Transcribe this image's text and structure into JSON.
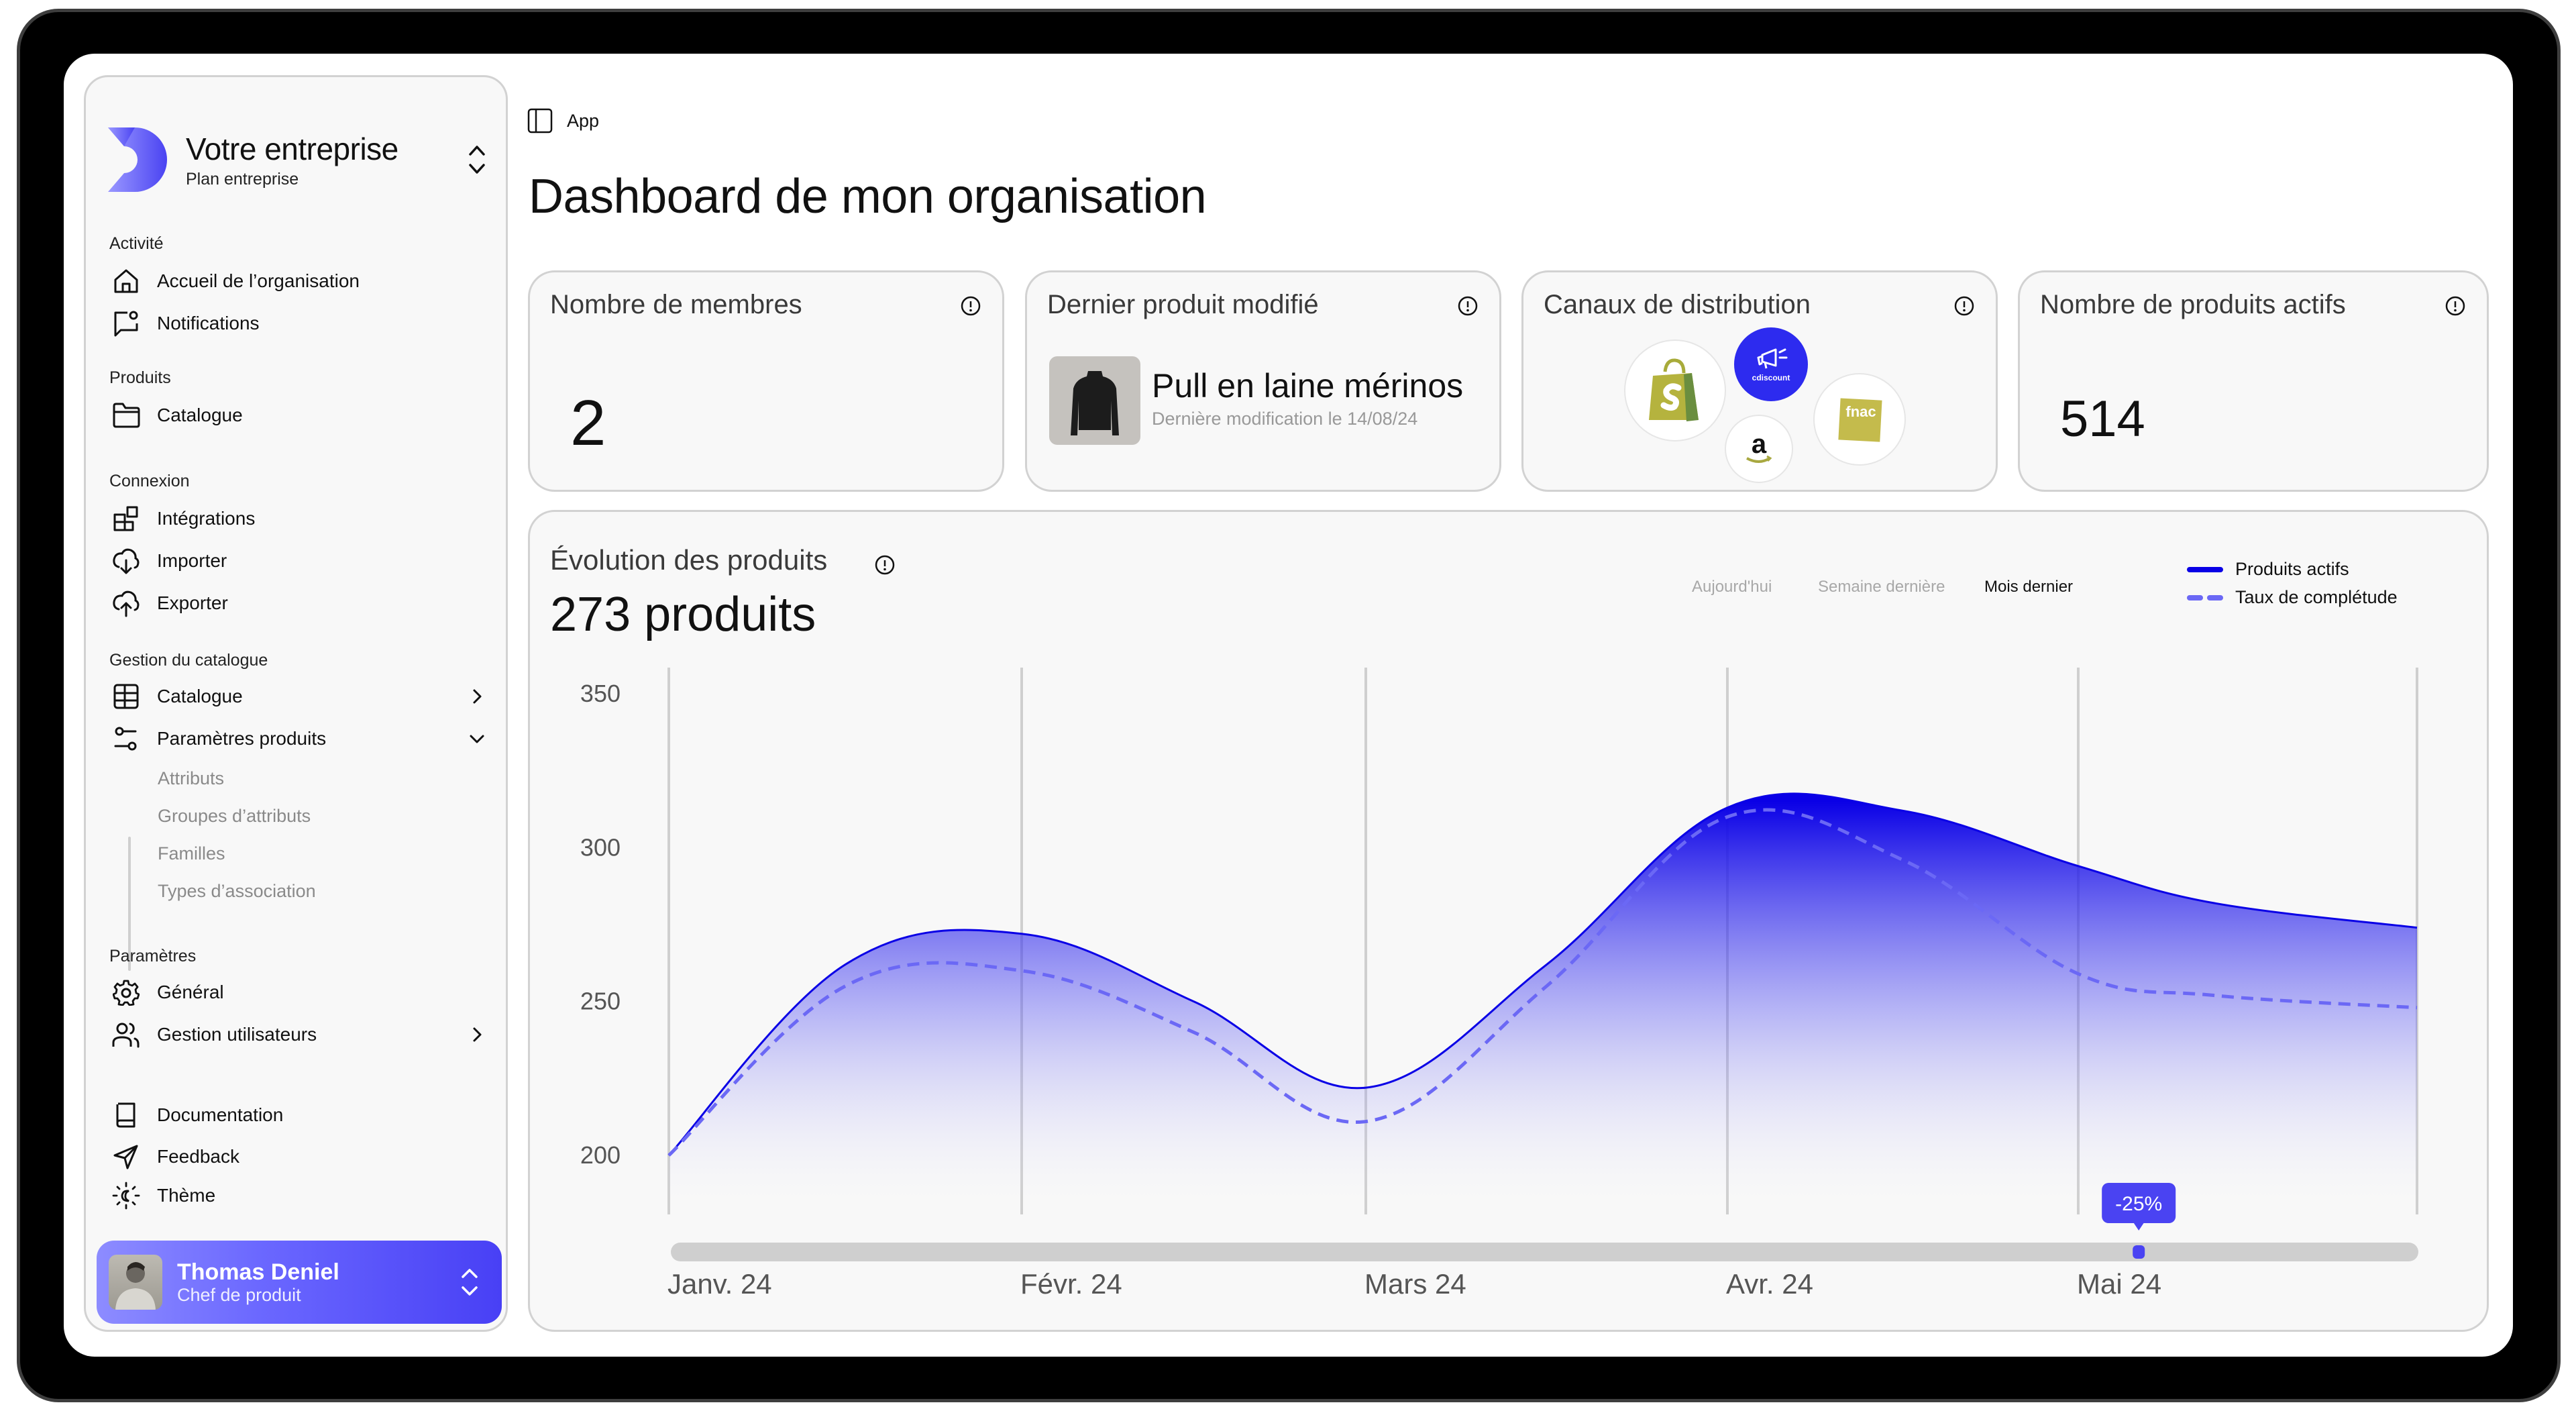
{
  "org": {
    "name": "Votre entreprise",
    "plan": "Plan entreprise",
    "logo_color": "#4a43f2"
  },
  "sidebar": {
    "sections": [
      {
        "label": "Activité",
        "items": [
          {
            "label": "Accueil de l’organisation",
            "icon": "home-icon"
          },
          {
            "label": "Notifications",
            "icon": "notification-icon"
          }
        ]
      },
      {
        "label": "Produits",
        "items": [
          {
            "label": "Catalogue",
            "icon": "folder-icon"
          }
        ]
      },
      {
        "label": "Connexion",
        "items": [
          {
            "label": "Intégrations",
            "icon": "integrations-icon"
          },
          {
            "label": "Importer",
            "icon": "cloud-download-icon"
          },
          {
            "label": "Exporter",
            "icon": "cloud-upload-icon"
          }
        ]
      },
      {
        "label": "Gestion du catalogue",
        "items": [
          {
            "label": "Catalogue",
            "icon": "table-icon",
            "chevron": "right"
          },
          {
            "label": "Paramètres produits",
            "icon": "sliders-icon",
            "chevron": "down",
            "children": [
              "Attributs",
              "Groupes d’attributs",
              "Familles",
              "Types d’association"
            ]
          }
        ]
      },
      {
        "label": "Paramètres",
        "items": [
          {
            "label": "Général",
            "icon": "gear-icon"
          },
          {
            "label": "Gestion utilisateurs",
            "icon": "users-icon",
            "chevron": "right"
          }
        ]
      }
    ],
    "footer_items": [
      {
        "label": "Documentation",
        "icon": "book-icon"
      },
      {
        "label": "Feedback",
        "icon": "send-icon"
      },
      {
        "label": "Thème",
        "icon": "theme-icon"
      }
    ],
    "user": {
      "name": "Thomas Deniel",
      "role": "Chef de produit"
    }
  },
  "header": {
    "breadcrumb": "App",
    "title": "Dashboard de mon organisation"
  },
  "kpis": {
    "members": {
      "title": "Nombre de membres",
      "value": "2"
    },
    "last_product": {
      "title": "Dernier produit modifié",
      "name": "Pull en laine mérinos",
      "date": "Dernière modification le 14/08/24"
    },
    "channels": {
      "title": "Canaux de distribution",
      "items": [
        "Shopify",
        "Cdiscount",
        "Amazon",
        "Fnac"
      ]
    },
    "active_products": {
      "title": "Nombre de produits actifs",
      "value": "514"
    }
  },
  "chart_panel": {
    "title": "Évolution des produits",
    "total": "273 produits",
    "ranges": [
      "Aujourd'hui",
      "Semaine dernière",
      "Mois dernier"
    ],
    "active_range": "Mois dernier",
    "slider": {
      "position_fraction": 0.84,
      "tooltip": "-25%"
    }
  },
  "chart_data": {
    "type": "area",
    "title": "Évolution des produits",
    "xlabel": "",
    "ylabel": "",
    "categories": [
      "Janv. 24",
      "Févr. 24",
      "Mars 24",
      "Avr. 24",
      "Mai 24"
    ],
    "x": [
      0,
      0.5,
      1,
      1.5,
      2,
      2.5,
      3,
      3.5,
      4,
      4.4,
      5
    ],
    "ylim": [
      200,
      350
    ],
    "yticks": [
      200,
      250,
      300,
      350
    ],
    "grid": "vertical",
    "legend_position": "top-right",
    "series": [
      {
        "name": "Produits actifs",
        "style": "solid-filled",
        "color": "#0a00e6",
        "values": [
          200,
          262,
          272,
          250,
          222,
          262,
          313,
          312,
          294,
          282,
          274
        ]
      },
      {
        "name": "Taux de complétude",
        "style": "dashed",
        "color": "#6b68f5",
        "values": [
          200,
          255,
          260,
          240,
          211,
          255,
          310,
          296,
          259,
          252,
          248
        ]
      }
    ]
  },
  "colors": {
    "accent": "#4a43f2",
    "line": "#0a00e6",
    "dashed": "#6b68f5",
    "card_bg": "#f8f8f8",
    "card_border": "#d2d2d2"
  }
}
